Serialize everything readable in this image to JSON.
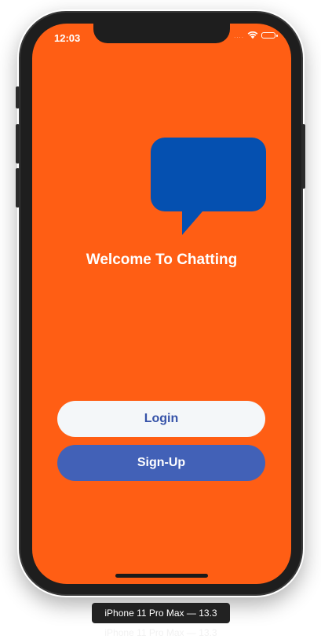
{
  "status_bar": {
    "time": "12:03",
    "signal": "....",
    "wifi_icon": "wifi-icon",
    "battery_icon": "battery-icon"
  },
  "app": {
    "logo_icon": "chat-bubble-icon",
    "welcome_text": "Welcome To Chatting",
    "login_label": "Login",
    "signup_label": "Sign-Up"
  },
  "simulator": {
    "device_label": "iPhone 11 Pro Max — 13.3"
  },
  "colors": {
    "background": "#ff5e14",
    "bubble": "#0550b0",
    "login_bg": "#f4f7f9",
    "login_text": "#3552a8",
    "signup_bg": "#4261b7",
    "signup_text": "#ffffff"
  }
}
